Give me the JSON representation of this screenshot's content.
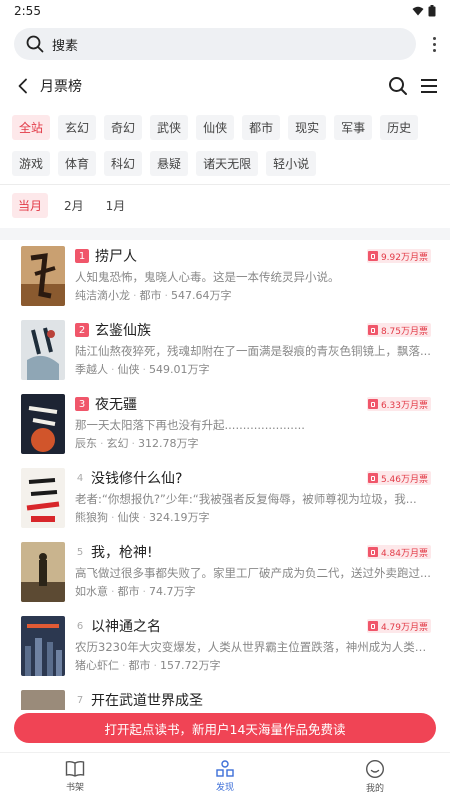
{
  "status_bar": {
    "time": "2:55"
  },
  "search": {
    "label": "搜素"
  },
  "header": {
    "title": "月票榜"
  },
  "categories_row1": [
    "全站",
    "玄幻",
    "奇幻",
    "武侠",
    "仙侠",
    "都市",
    "现实",
    "军事",
    "历史"
  ],
  "categories_row2": [
    "游戏",
    "体育",
    "科幻",
    "悬疑",
    "诸天无限",
    "轻小说"
  ],
  "active_category": "全站",
  "periods": [
    "当月",
    "2月",
    "1月"
  ],
  "active_period": "当月",
  "books": [
    {
      "rank": "1",
      "title": "捞尸人",
      "votes": "9.92万月票",
      "desc": "人知鬼恐怖，鬼晓人心毒。这是一本传统灵异小说。",
      "author": "纯洁滴小龙",
      "genre": "都市",
      "words": "547.64万字"
    },
    {
      "rank": "2",
      "title": "玄鉴仙族",
      "votes": "8.75万月票",
      "desc": "陆江仙熬夜猝死，残魂却附在了一面满是裂痕的青灰色铜镜上，飘落...",
      "author": "季越人",
      "genre": "仙侠",
      "words": "549.01万字"
    },
    {
      "rank": "3",
      "title": "夜无疆",
      "votes": "6.33万月票",
      "desc": "那一天太阳落下再也没有升起......................",
      "author": "辰东",
      "genre": "玄幻",
      "words": "312.78万字"
    },
    {
      "rank": "4",
      "title": "没钱修什么仙?",
      "votes": "5.46万月票",
      "desc": "老者:“你想报仇?”少年:“我被强者反复侮辱，被师尊视为垃圾，我...",
      "author": "熊狼狗",
      "genre": "仙侠",
      "words": "324.19万字"
    },
    {
      "rank": "5",
      "title": "我，枪神!",
      "votes": "4.84万月票",
      "desc": "高飞做过很多事都失败了。家里工厂破产成为负二代，送过外卖跑过...",
      "author": "如水意",
      "genre": "都市",
      "words": "74.7万字"
    },
    {
      "rank": "6",
      "title": "以神通之名",
      "votes": "4.79万月票",
      "desc": "农历3230年大灾变爆发，人类从世界霸主位置跌落，神州成为人类最...",
      "author": "猪心虾仁",
      "genre": "都市",
      "words": "157.72万字"
    },
    {
      "rank": "7",
      "title": "开在武道世界成圣",
      "votes": "",
      "desc": "",
      "author": "",
      "genre": "",
      "words": ""
    }
  ],
  "banner": {
    "text": "打开起点读书，新用户14天海量作品免费读"
  },
  "bottom_nav": [
    {
      "label": "书架",
      "icon": "book-icon"
    },
    {
      "label": "发现",
      "icon": "discover-icon"
    },
    {
      "label": "我的",
      "icon": "profile-icon"
    }
  ],
  "colors": {
    "accent": "#e23a47",
    "banner": "#f04455",
    "nav_active": "#3d6fd8"
  }
}
